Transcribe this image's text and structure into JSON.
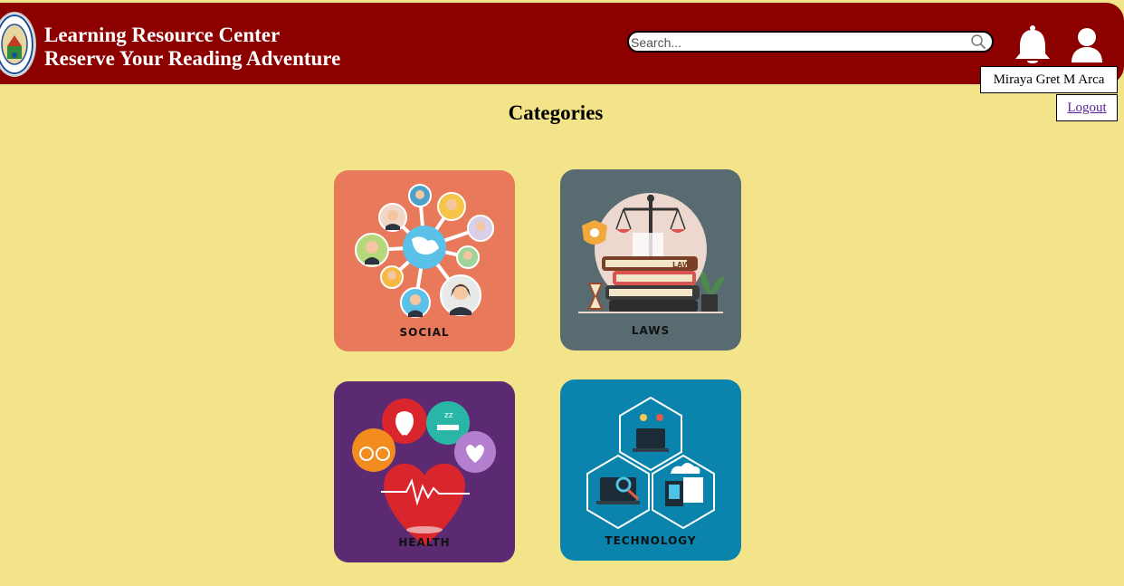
{
  "header": {
    "title_line1": "Learning Resource Center",
    "title_line2": "Reserve Your Reading Adventure",
    "logo_icon": "college-seal-logo"
  },
  "search": {
    "placeholder": "Search...",
    "icon": "search-icon"
  },
  "user_menu": {
    "notification_icon": "bell-icon",
    "user_icon": "user-icon",
    "user_name": "Miraya Gret M Arca",
    "logout_label": "Logout"
  },
  "main": {
    "heading": "Categories",
    "categories": [
      {
        "label": "SOCIAL",
        "bg": "#e8795b"
      },
      {
        "label": "LAWS",
        "bg": "#586b70"
      },
      {
        "label": "HEALTH",
        "bg": "#5c2a72"
      },
      {
        "label": "TECHNOLOGY",
        "bg": "#0a83ad"
      }
    ]
  },
  "colors": {
    "page_bg": "#f3e48a",
    "header_bg": "#8c0000"
  }
}
